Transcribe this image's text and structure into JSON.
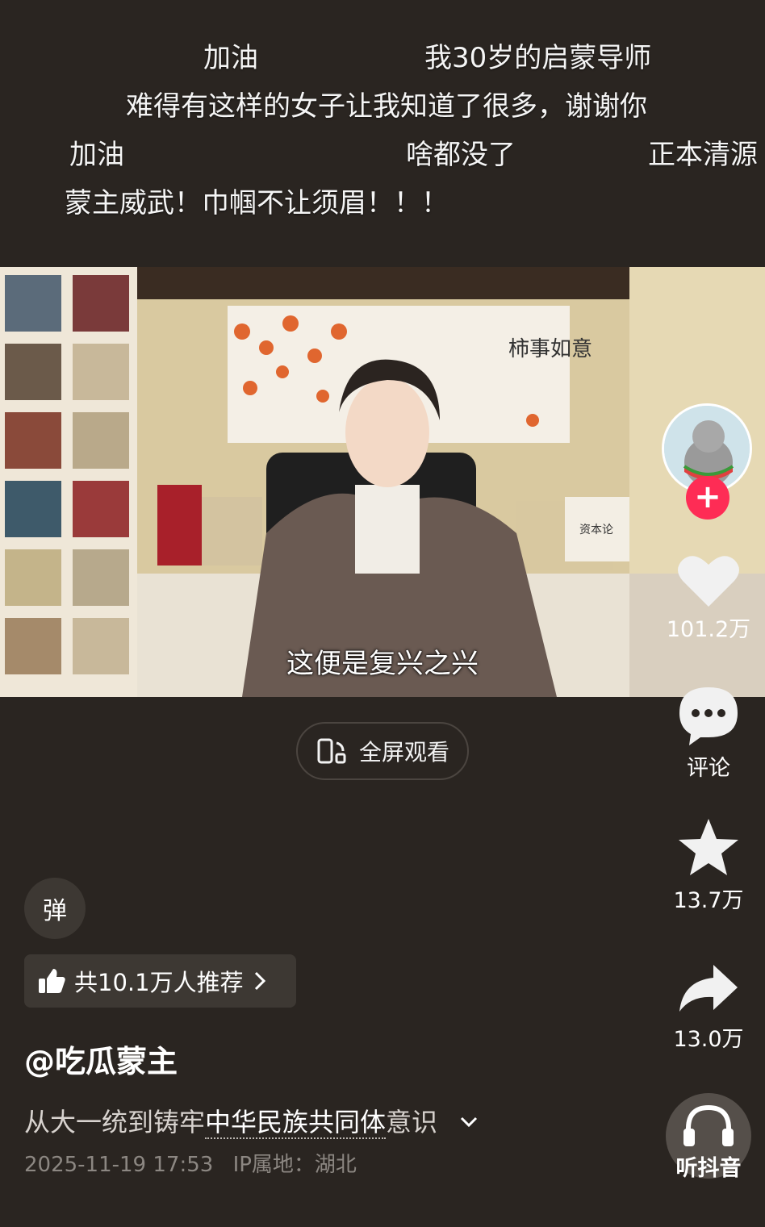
{
  "danmaku": [
    "加油",
    "我30岁的启蒙导师",
    "难得有这样的女子让我知道了很多，谢谢你",
    "加油",
    "啥都没了",
    "正本清源",
    "蒙主威武！巾帼不让须眉！！！"
  ],
  "video": {
    "subtitle": "这便是复兴之兴",
    "fullscreen_label": "全屏观看",
    "scroll_text": "柿事如意",
    "book_label": "资本论"
  },
  "actions": {
    "likes": "101.2万",
    "comment_label": "评论",
    "favorites": "13.7万",
    "shares": "13.0万",
    "listen_label": "听抖音"
  },
  "bottom": {
    "danmu_toggle": "弹",
    "recommend_text": "共10.1万人推荐",
    "username": "@吃瓜蒙主",
    "description_prefix": "从大一统到铸牢",
    "description_highlight": "中华民族共同体",
    "description_suffix": "意识",
    "timestamp": "2025-11-19 17:53",
    "ip_location": "IP属地：湖北"
  },
  "colors": {
    "background": "#2a2521",
    "follow_accent": "#fe2c55"
  }
}
